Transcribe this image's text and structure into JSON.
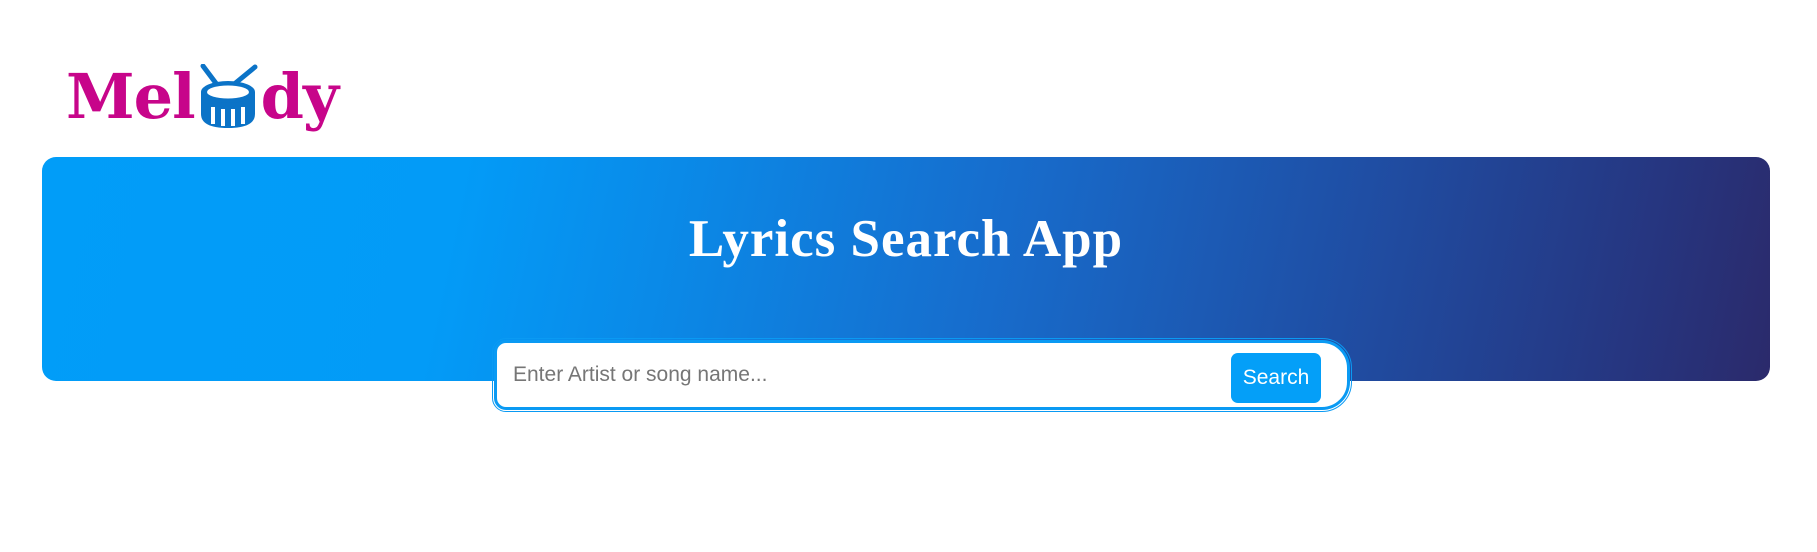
{
  "brand": {
    "logo_text_left": "Mel",
    "logo_text_right": "dy",
    "logo_icon": "drum-icon",
    "logo_color": "#c7058a",
    "drum_color": "#0b73c7"
  },
  "hero": {
    "title": "Lyrics Search App",
    "gradient_start": "#019df8",
    "gradient_end": "#2b2a6b"
  },
  "search": {
    "placeholder": "Enter Artist or song name...",
    "value": "",
    "button_label": "Search",
    "accent": "#049ff8"
  }
}
